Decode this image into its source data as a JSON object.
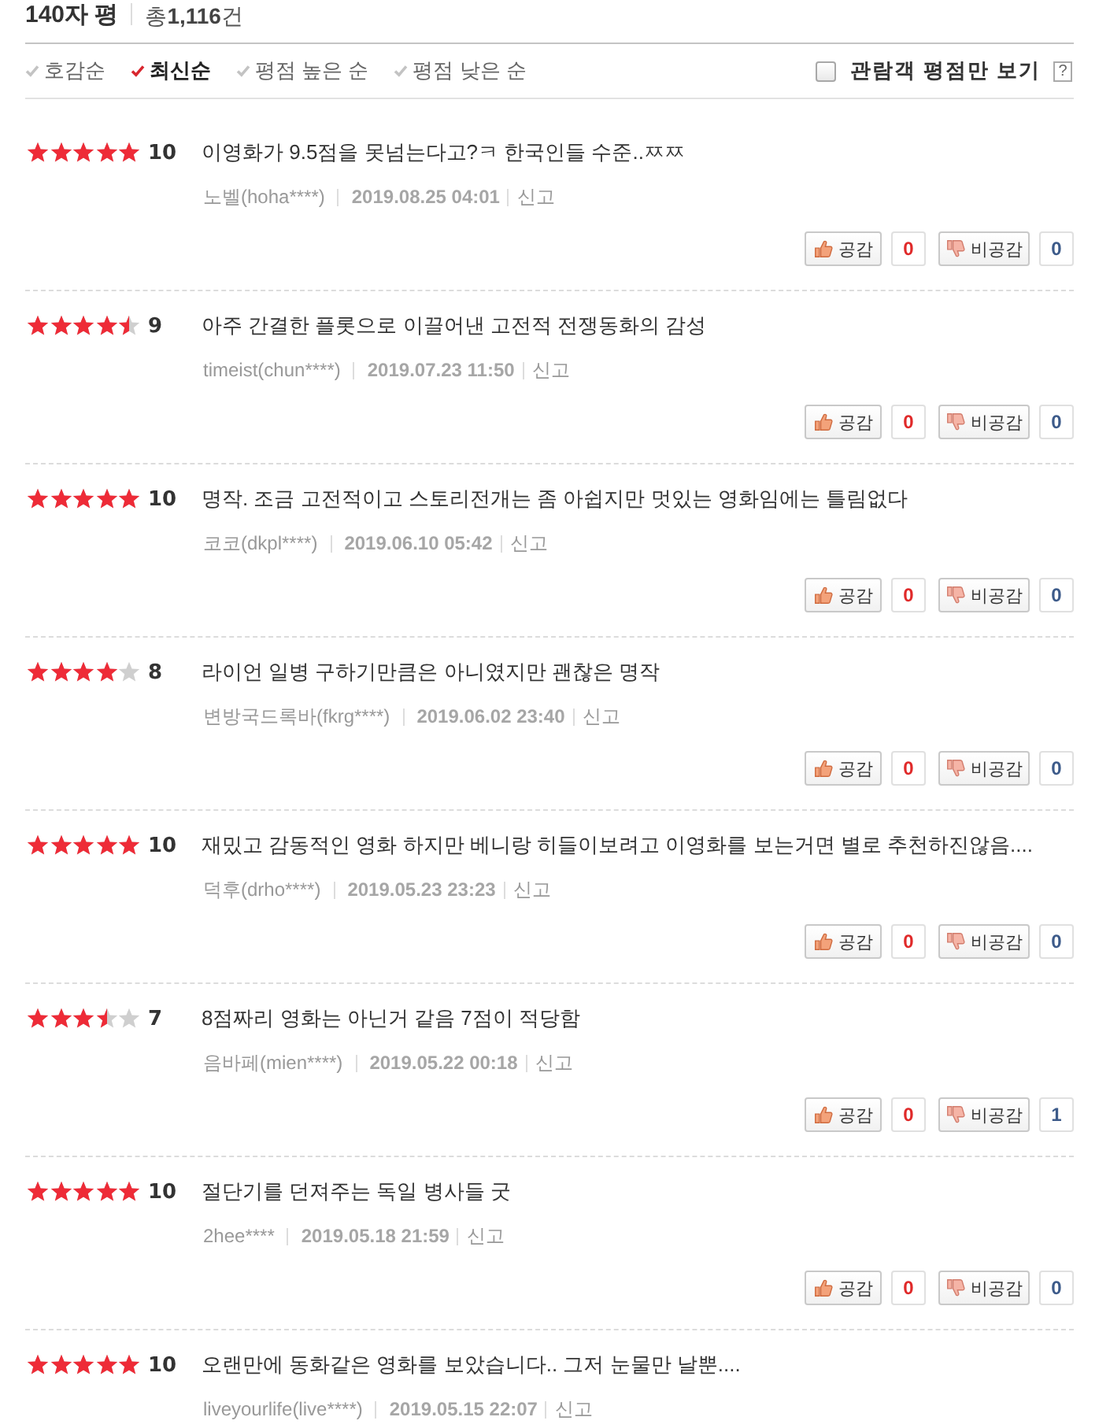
{
  "header": {
    "title": "140자 평",
    "total": "총**1,116**건"
  },
  "sort_options": [
    {
      "label": "호감순",
      "selected": false
    },
    {
      "label": "최신순",
      "selected": true
    },
    {
      "label": "평점 높은 순",
      "selected": false
    },
    {
      "label": "평점 낮은 순",
      "selected": false
    }
  ],
  "filter": {
    "label": "관람객 평점만 보기",
    "checked": false,
    "help": "?"
  },
  "reviews": [
    {
      "stars": 5,
      "score": "10",
      "text": "이영화가 9.5점을 못넘는다고?ㅋ 한국인들 수준..ㅉㅉ",
      "author": "노벨(hoha****)",
      "date": "2019.08.25 04:01",
      "report": "신고",
      "likes": {
        "label": "공감",
        "count": "0"
      },
      "dislikes": {
        "label": "비공감",
        "count": "0"
      }
    },
    {
      "stars": 4.5,
      "score": "9",
      "text": "아주 간결한 플롯으로 이끌어낸 고전적 전쟁동화의 감성",
      "author": "timeist(chun****)",
      "date": "2019.07.23 11:50",
      "report": "신고",
      "likes": {
        "label": "공감",
        "count": "0"
      },
      "dislikes": {
        "label": "비공감",
        "count": "0"
      }
    },
    {
      "stars": 5,
      "score": "10",
      "text": "명작. 조금 고전적이고 스토리전개는 좀 아쉽지만 멋있는 영화임에는 틀림없다",
      "author": "코코(dkpl****)",
      "date": "2019.06.10 05:42",
      "report": "신고",
      "likes": {
        "label": "공감",
        "count": "0"
      },
      "dislikes": {
        "label": "비공감",
        "count": "0"
      }
    },
    {
      "stars": 4,
      "score": "8",
      "text": "라이언 일병 구하기만큼은 아니였지만 괜찮은 명작",
      "author": "변방국드록바(fkrg****)",
      "date": "2019.06.02 23:40",
      "report": "신고",
      "likes": {
        "label": "공감",
        "count": "0"
      },
      "dislikes": {
        "label": "비공감",
        "count": "0"
      }
    },
    {
      "stars": 5,
      "score": "10",
      "text": "재밌고 감동적인 영화 하지만 베니랑 히들이보려고 이영화를 보는거면 별로 추천하진않음....",
      "author": "덕후(drho****)",
      "date": "2019.05.23 23:23",
      "report": "신고",
      "likes": {
        "label": "공감",
        "count": "0"
      },
      "dislikes": {
        "label": "비공감",
        "count": "0"
      }
    },
    {
      "stars": 3.5,
      "score": "7",
      "text": "8점짜리 영화는 아닌거 같음 7점이 적당함",
      "author": "음바페(mien****)",
      "date": "2019.05.22 00:18",
      "report": "신고",
      "likes": {
        "label": "공감",
        "count": "0"
      },
      "dislikes": {
        "label": "비공감",
        "count": "1"
      }
    },
    {
      "stars": 5,
      "score": "10",
      "text": "절단기를 던져주는 독일 병사들 굿",
      "author": "2hee****",
      "date": "2019.05.18 21:59",
      "report": "신고",
      "likes": {
        "label": "공감",
        "count": "0"
      },
      "dislikes": {
        "label": "비공감",
        "count": "0"
      }
    },
    {
      "stars": 5,
      "score": "10",
      "text": "오랜만에 동화같은 영화를 보았습니다.. 그저 눈물만 날뿐....",
      "author": "liveyourlife(live****)",
      "date": "2019.05.15 22:07",
      "report": "신고"
    }
  ]
}
